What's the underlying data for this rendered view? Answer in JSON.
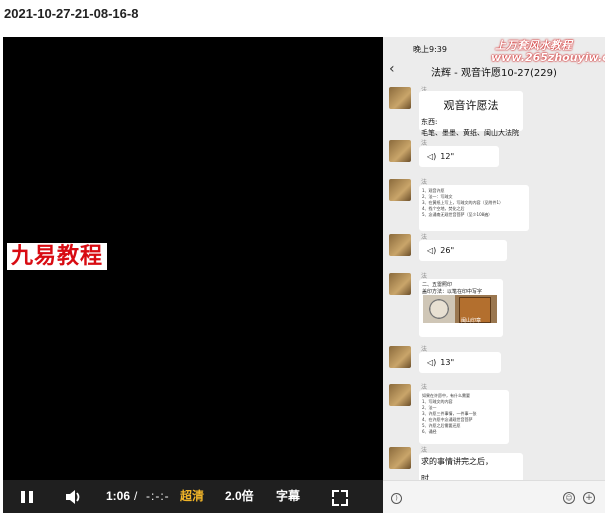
{
  "page": {
    "title": "2021-10-27-21-08-16-8"
  },
  "video": {
    "watermark_left": "九易教程",
    "phone": {
      "status_time": "晚上9:39",
      "chat_title": "法辉 - 观音许愿10-27(229)",
      "back_icon": "back-arrow-icon",
      "watermark_top": "上万套风水教程",
      "watermark_url": "www.265zhouyiw.com",
      "messages": [
        {
          "sender": "法辉",
          "doc_title": "观音许愿法",
          "doc_lines": [
            "东西:",
            "毛笔、墨墨、黄纸、闽山大法院"
          ]
        },
        {
          "sender": "法辉",
          "voice": "12\""
        },
        {
          "sender": "法辉",
          "tiny_lines": [
            "1、观音许愿",
            "2、法一：写疏文",
            "3、在黄纸上写上，写疏文的内容（见附件1）",
            "4、找个空地，焚化之后",
            "5、念诵南无观世音菩萨（至少108遍）"
          ]
        },
        {
          "sender": "法辉",
          "voice": "26\""
        },
        {
          "sender": "法辉",
          "text_lines": [
            "二、五雷照印",
            "盖印方法：以笔在印中写字"
          ],
          "image_caption": "闽山印章"
        },
        {
          "sender": "法辉",
          "voice": "13\""
        },
        {
          "sender": "法辉",
          "tiny_lines": [
            "如果在许愿中，有什么需要",
            "1、写疏文的内容",
            "2、法一",
            "3、许愿三件事情，一件事一张",
            "4、在许愿中念诵观世音菩萨",
            "5、许愿之后需要还愿",
            "6、诵经"
          ]
        },
        {
          "sender": "法辉",
          "text_lines": [
            "求的事情讲完之后，",
            "时"
          ]
        }
      ],
      "input_icons": [
        "voice-icon",
        "emoji-icon",
        "plus-icon"
      ]
    }
  },
  "controls": {
    "time_current": "1:06",
    "time_separator": "/",
    "time_total": "-:-:-",
    "quality_label": "超清",
    "speed_label": "2.0倍",
    "subtitle_label": "字幕",
    "quality_color": "#f0b429"
  }
}
